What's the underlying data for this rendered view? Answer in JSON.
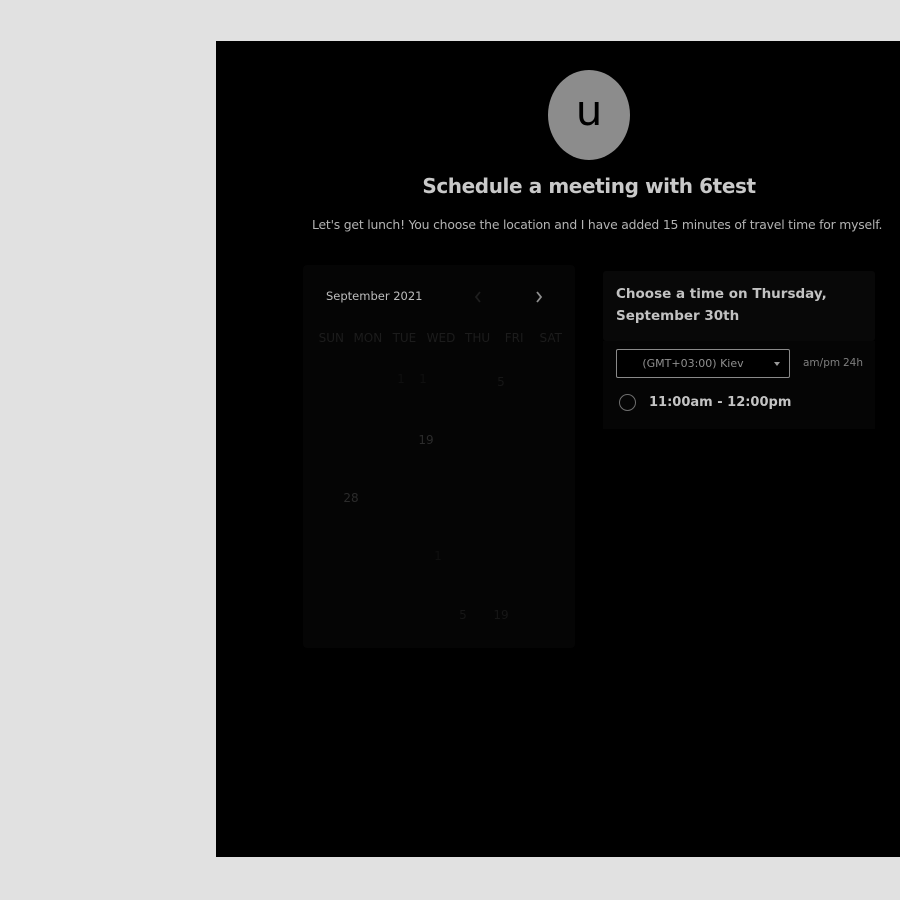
{
  "avatar": {
    "letter": "u",
    "color": "#8c8c8c"
  },
  "header": {
    "title": "Schedule a meeting with 6test",
    "subtitle": "Let's get lunch! You choose the location and I have added 15 minutes of travel time for myself."
  },
  "calendar": {
    "month_label": "September 2021",
    "prev_icon": "chevron-left-icon",
    "next_icon": "chevron-right-icon",
    "weekdays": [
      "SUN",
      "MON",
      "TUE",
      "WED",
      "THU",
      "FRI",
      "SAT"
    ],
    "visible_days": [
      "1",
      "1",
      "5",
      "19",
      "28",
      "1",
      "5",
      "19"
    ]
  },
  "time_panel": {
    "heading": "Choose a time on Thursday, September 30th",
    "timezone": "(GMT+03:00) Kiev",
    "format_ampm": "am/pm",
    "format_24h": "24h",
    "slots": [
      {
        "label": "11:00am - 12:00pm"
      }
    ]
  },
  "colors": {
    "page_bg": "#e1e1e1",
    "panel_bg": "#000000",
    "title": "#c9c9c9"
  }
}
